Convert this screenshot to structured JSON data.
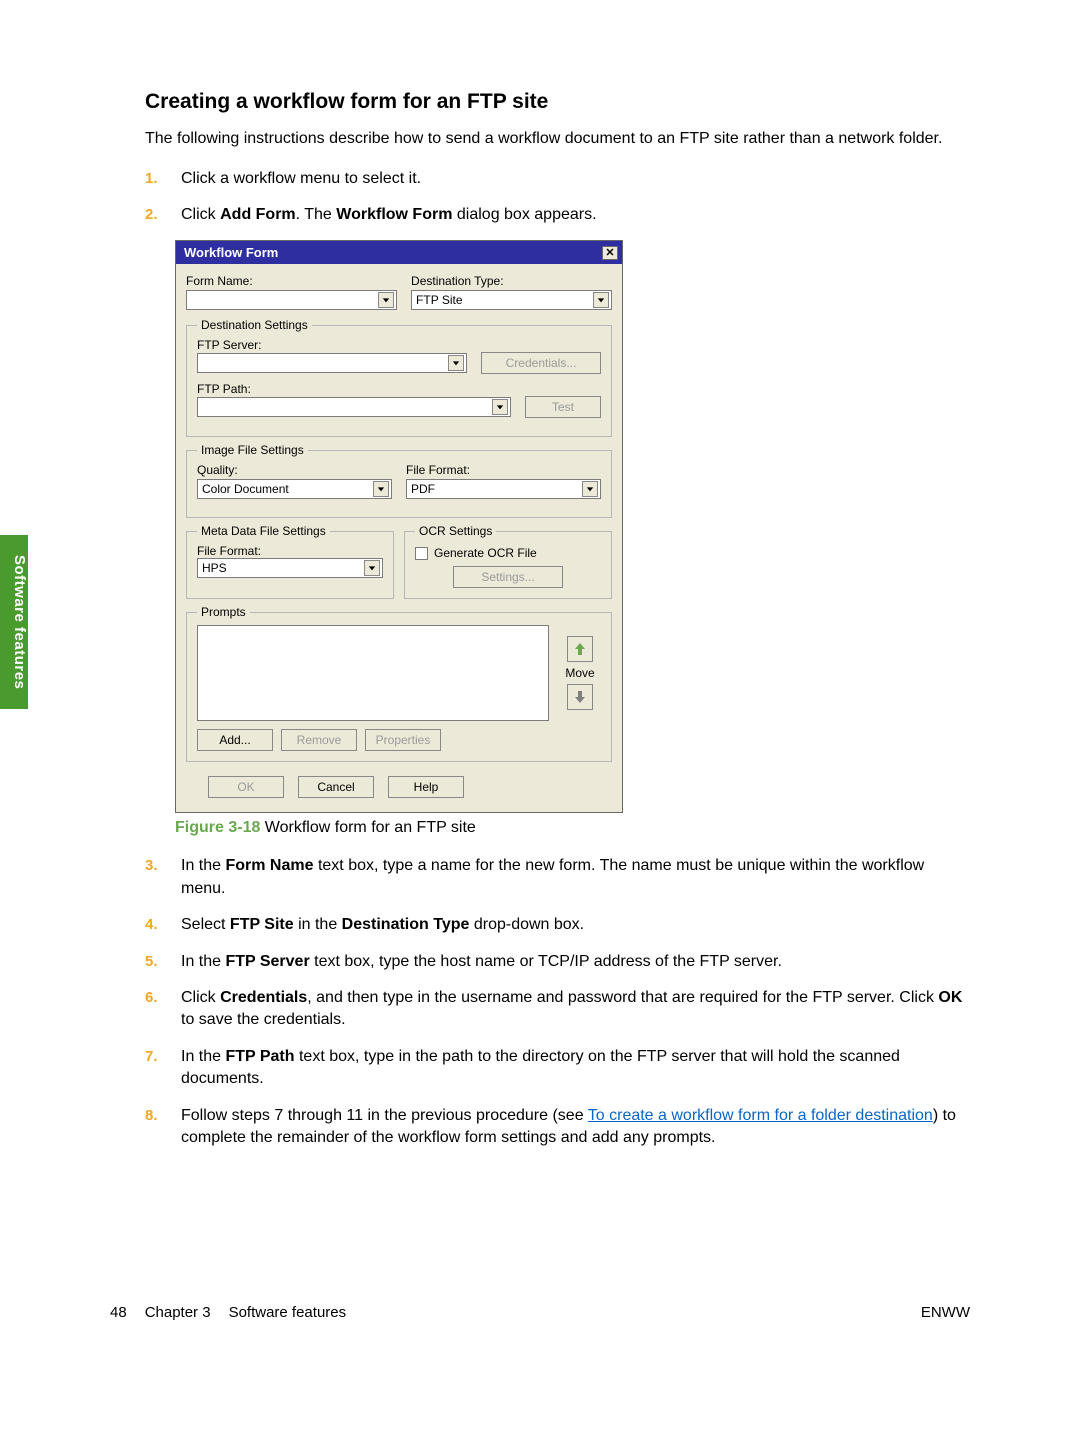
{
  "heading": "Creating a workflow form for an FTP site",
  "intro": "The following instructions describe how to send a workflow document to an FTP site rather than a network folder.",
  "steps_top": [
    {
      "num": "1.",
      "text_a": "Click a workflow menu to select it."
    },
    {
      "num": "2.",
      "text_a": "Click ",
      "bold1": "Add Form",
      "text_b": ". The ",
      "bold2": "Workflow Form",
      "text_c": " dialog box appears."
    }
  ],
  "figure": {
    "label": "Figure 3-18",
    "caption": "  Workflow form for an FTP site"
  },
  "steps_bottom": [
    {
      "num": "3.",
      "text_a": "In the ",
      "bold1": "Form Name",
      "text_b": " text box, type a name for the new form. The name must be unique within the workflow menu."
    },
    {
      "num": "4.",
      "text_a": "Select ",
      "bold1": "FTP Site",
      "text_b": " in the ",
      "bold2": "Destination Type",
      "text_c": " drop-down box."
    },
    {
      "num": "5.",
      "text_a": "In the ",
      "bold1": "FTP Server",
      "text_b": " text box, type the host name or TCP/IP address of the FTP server."
    },
    {
      "num": "6.",
      "text_a": "Click ",
      "bold1": "Credentials",
      "text_b": ", and then type in the username and password that are required for the FTP server. Click ",
      "bold2": "OK",
      "text_c": " to save the credentials."
    },
    {
      "num": "7.",
      "text_a": "In the ",
      "bold1": "FTP Path",
      "text_b": " text box, type in the path to the directory on the FTP server that will hold the scanned documents."
    },
    {
      "num": "8.",
      "text_a": "Follow steps 7 through 11 in the previous procedure (see ",
      "link": "To create a workflow form for a folder destination",
      "text_b": ") to complete the remainder of the workflow form settings and add any prompts."
    }
  ],
  "dialog": {
    "title": "Workflow Form",
    "formNameLabel": "Form Name:",
    "destTypeLabel": "Destination Type:",
    "destTypeValue": "FTP Site",
    "groupDest": "Destination Settings",
    "ftpServerLabel": "FTP Server:",
    "credentials": "Credentials...",
    "ftpPathLabel": "FTP Path:",
    "test": "Test",
    "groupImage": "Image File Settings",
    "qualityLabel": "Quality:",
    "qualityValue": "Color Document",
    "fileFormatLabel": "File Format:",
    "fileFormatValue": "PDF",
    "groupMeta": "Meta Data File Settings",
    "metaFileFormatLabel": "File Format:",
    "metaFileFormatValue": "HPS",
    "groupOcr": "OCR Settings",
    "ocrGenerate": "Generate OCR File",
    "ocrSettings": "Settings...",
    "groupPrompts": "Prompts",
    "moveLabel": "Move",
    "add": "Add...",
    "remove": "Remove",
    "properties": "Properties",
    "ok": "OK",
    "cancel": "Cancel",
    "help": "Help"
  },
  "sidebar": "Software features",
  "footer": {
    "page": "48",
    "chapter": "Chapter 3",
    "chapterTitle": "Software features",
    "right": "ENWW"
  }
}
